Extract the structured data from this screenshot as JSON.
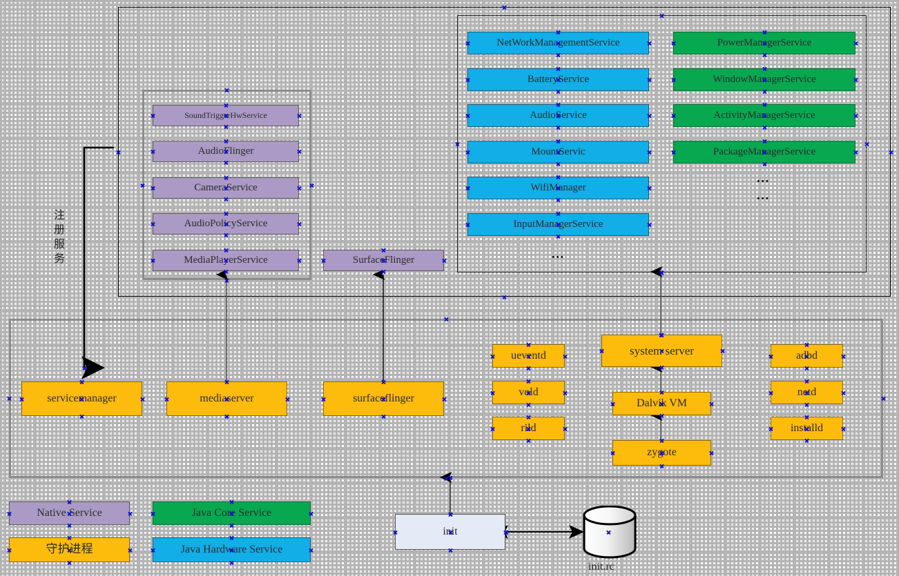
{
  "title": "Android System Services Architecture Diagram",
  "colors": {
    "native_service": "#ab9ac5",
    "java_hardware_service": "#11AEE8",
    "java_core_service": "#08A851",
    "daemon": "#FDBB0C",
    "init": "#e4eaf6",
    "handle": "#1111cc"
  },
  "annotations": {
    "register_service": "注册服务"
  },
  "native_services": [
    {
      "label": "SoundTriggerHwService"
    },
    {
      "label": "AudioFlinger"
    },
    {
      "label": "CameraService"
    },
    {
      "label": "AudioPolicyService"
    },
    {
      "label": "MediaPlayerService"
    }
  ],
  "surface_flinger": {
    "label": "SurfaceFlinger"
  },
  "java_hardware_services": [
    {
      "label": "NetWorkManagementService"
    },
    {
      "label": "BatteryService"
    },
    {
      "label": "AudioService"
    },
    {
      "label": "MountServic"
    },
    {
      "label": "WifiManager"
    },
    {
      "label": "InputManagerService"
    }
  ],
  "java_hardware_more": "...",
  "java_core_services": [
    {
      "label": "PowerManagerService"
    },
    {
      "label": "WindowManagerService"
    },
    {
      "label": "ActivityManagerService"
    },
    {
      "label": "PackageManagerService"
    }
  ],
  "java_core_more": [
    "...",
    "..."
  ],
  "daemons": {
    "service_manager": "servicemanager",
    "media_server": "mediaserver",
    "surface_flinger": "surfaceflinger",
    "ueventd": "ueventd",
    "vold": "vold",
    "rild": "rild",
    "system_server": "system server",
    "dalvik_vm": "Dalvik VM",
    "zygote": "zygote",
    "adbd": "adbd",
    "netd": "netd",
    "installd": "installd"
  },
  "init": {
    "label": "init",
    "config_label": "init.rc"
  },
  "legend": [
    {
      "label": "Native Service",
      "color": "#ab9ac5"
    },
    {
      "label": "Java Core Service",
      "color": "#08A851"
    },
    {
      "label": "守护进程",
      "color": "#FDBB0C"
    },
    {
      "label": "Java Hardware Service",
      "color": "#11AEE8"
    }
  ]
}
